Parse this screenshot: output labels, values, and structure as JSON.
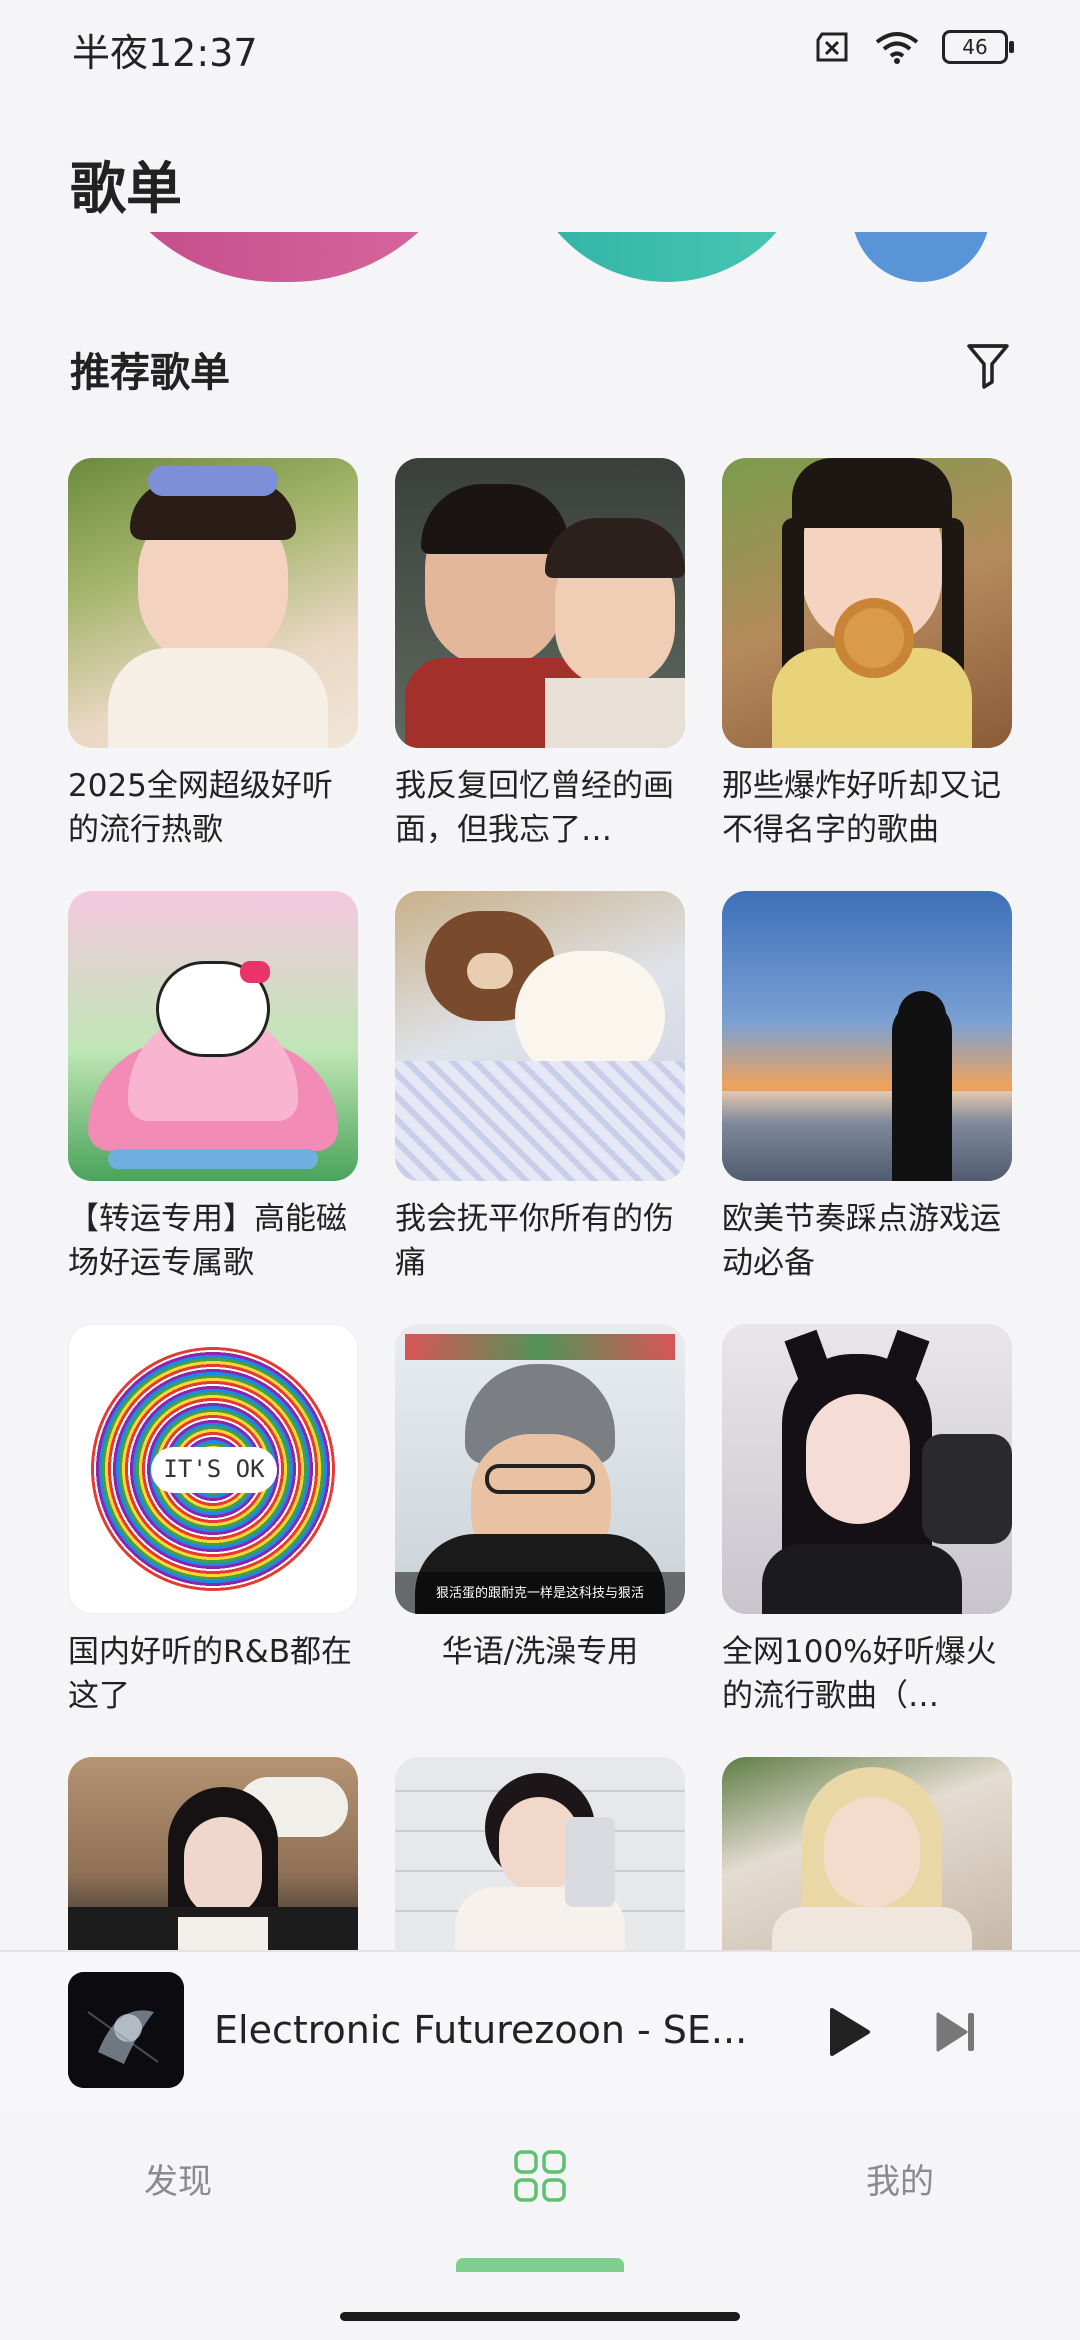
{
  "status": {
    "time": "半夜12:37",
    "battery": "46"
  },
  "header": {
    "title": "歌单"
  },
  "section": {
    "title": "推荐歌单"
  },
  "playlists": [
    {
      "title": "2025全网超级好听的流行热歌"
    },
    {
      "title": "我反复回忆曾经的画面，但我忘了…"
    },
    {
      "title": "那些爆炸好听却又记不得名字的歌曲"
    },
    {
      "title": "【转运专用】高能磁场好运专属歌"
    },
    {
      "title": "我会抚平你所有的伤痛"
    },
    {
      "title": "欧美节奏踩点游戏运动必备"
    },
    {
      "title": "国内好听的R&B都在这了"
    },
    {
      "title": "华语/洗澡专用"
    },
    {
      "title": "全网100%好听爆火的流行歌曲（…"
    }
  ],
  "cover_text": {
    "its_ok": "IT'S OK",
    "subtitle": "狠活蛋的跟耐克一样是这科技与狠活"
  },
  "player": {
    "title": "Electronic Futurezoon - SE..."
  },
  "nav": {
    "discover": "发现",
    "mine": "我的"
  },
  "colors": {
    "accent": "#5cc26f",
    "text": "#222222",
    "background": "#f5f5f7"
  }
}
